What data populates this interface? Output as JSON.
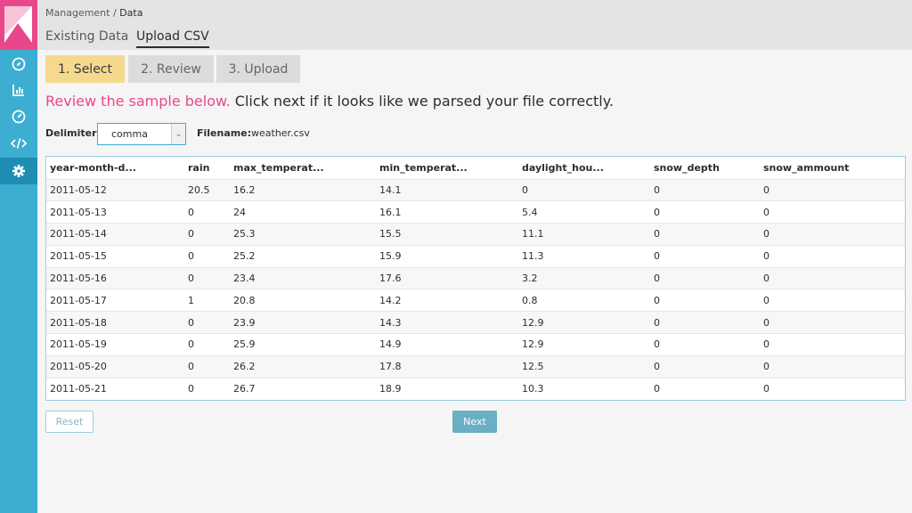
{
  "breadcrumb": {
    "parent": "Management",
    "separator": " / ",
    "current": "Data"
  },
  "tabs": [
    {
      "label": "Existing Data"
    },
    {
      "label": "Upload CSV"
    }
  ],
  "steps": [
    {
      "label": "1. Select"
    },
    {
      "label": "2. Review"
    },
    {
      "label": "3. Upload"
    }
  ],
  "heading": {
    "highlight": "Review the sample below.",
    "rest": " Click next if it looks like we parsed your file correctly."
  },
  "delimiter": {
    "label": "Delimiter",
    "value": "comma"
  },
  "filename": {
    "label": "Filename:",
    "value": "weather.csv"
  },
  "table": {
    "columns": [
      "year-month-d...",
      "rain",
      "max_temperat...",
      "min_temperat...",
      "daylight_hou...",
      "snow_depth",
      "snow_ammount"
    ],
    "rows": [
      [
        "2011-05-12",
        "20.5",
        "16.2",
        "14.1",
        "0",
        "0",
        "0"
      ],
      [
        "2011-05-13",
        "0",
        "24",
        "16.1",
        "5.4",
        "0",
        "0"
      ],
      [
        "2011-05-14",
        "0",
        "25.3",
        "15.5",
        "11.1",
        "0",
        "0"
      ],
      [
        "2011-05-15",
        "0",
        "25.2",
        "15.9",
        "11.3",
        "0",
        "0"
      ],
      [
        "2011-05-16",
        "0",
        "23.4",
        "17.6",
        "3.2",
        "0",
        "0"
      ],
      [
        "2011-05-17",
        "1",
        "20.8",
        "14.2",
        "0.8",
        "0",
        "0"
      ],
      [
        "2011-05-18",
        "0",
        "23.9",
        "14.3",
        "12.9",
        "0",
        "0"
      ],
      [
        "2011-05-19",
        "0",
        "25.9",
        "14.9",
        "12.9",
        "0",
        "0"
      ],
      [
        "2011-05-20",
        "0",
        "26.2",
        "17.8",
        "12.5",
        "0",
        "0"
      ],
      [
        "2011-05-21",
        "0",
        "26.7",
        "18.9",
        "10.3",
        "0",
        "0"
      ]
    ]
  },
  "buttons": {
    "reset": "Reset",
    "next": "Next"
  },
  "sidebar": {
    "items": [
      "compass-icon",
      "bar-chart-icon",
      "gauge-icon",
      "code-icon",
      "gear-icon"
    ]
  },
  "colors": {
    "sidebar": "#3caed2",
    "logo": "#e8488b",
    "active_step": "#f5d98e",
    "highlight": "#e8488b",
    "next_button": "#6aafc3"
  }
}
